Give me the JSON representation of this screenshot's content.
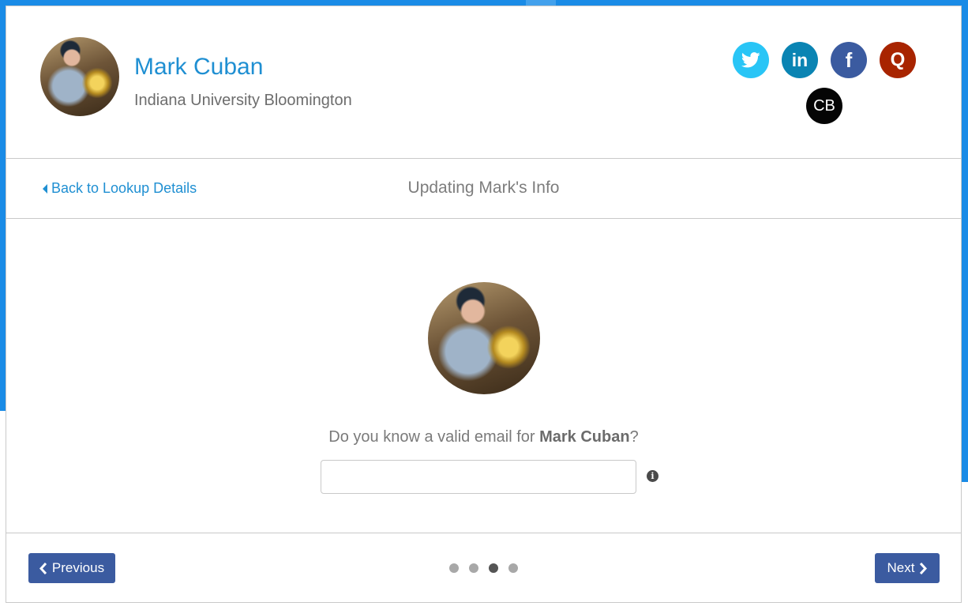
{
  "profile": {
    "name": "Mark Cuban",
    "school": "Indiana University Bloomington",
    "social": [
      {
        "id": "twitter",
        "icon": "twitter-icon",
        "color": "#29c5f6"
      },
      {
        "id": "linkedin",
        "icon": "linkedin-icon",
        "label": "in",
        "color": "#0a84b3"
      },
      {
        "id": "facebook",
        "icon": "facebook-icon",
        "label": "f",
        "color": "#3b5ba0"
      },
      {
        "id": "quora",
        "icon": "quora-icon",
        "label": "Q",
        "color": "#a82400"
      },
      {
        "id": "crunchbase",
        "icon": "crunchbase-icon",
        "label": "CB",
        "color": "#050505"
      }
    ]
  },
  "nav": {
    "back_label": "Back to Lookup Details",
    "title": "Updating Mark's Info"
  },
  "question": {
    "prefix": "Do you know a valid email for ",
    "name": "Mark Cuban",
    "suffix": "?"
  },
  "email_field": {
    "value": "",
    "placeholder": ""
  },
  "footer": {
    "previous_label": "Previous",
    "next_label": "Next",
    "steps_total": 4,
    "current_step": 3
  },
  "colors": {
    "accent": "#1f8fd2",
    "button": "#3b5ba0",
    "frame": "#1a8be6"
  }
}
